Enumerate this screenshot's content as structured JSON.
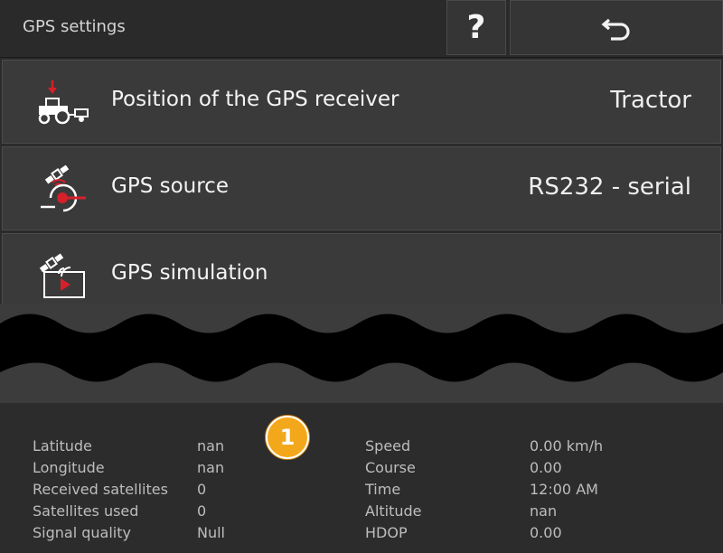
{
  "header": {
    "title": "GPS settings",
    "help_label": "?"
  },
  "menu": [
    {
      "label": "Position of the GPS receiver",
      "value": "Tractor",
      "icon": "tractor-receiver-icon"
    },
    {
      "label": "GPS source",
      "value": "RS232 - serial",
      "icon": "gps-source-icon"
    },
    {
      "label": "GPS simulation",
      "value": "",
      "icon": "gps-simulation-icon"
    }
  ],
  "callout": "1",
  "info": {
    "left": [
      {
        "label": "Latitude",
        "value": "nan"
      },
      {
        "label": "Longitude",
        "value": "nan"
      },
      {
        "label": "Received satellites",
        "value": "0"
      },
      {
        "label": "Satellites used",
        "value": "0"
      },
      {
        "label": "Signal quality",
        "value": "Null"
      }
    ],
    "right": [
      {
        "label": "Speed",
        "value": "0.00 km/h"
      },
      {
        "label": "Course",
        "value": "0.00"
      },
      {
        "label": "Time",
        "value": "12:00 AM"
      },
      {
        "label": "Altitude",
        "value": "nan"
      },
      {
        "label": "HDOP",
        "value": "0.00"
      }
    ]
  },
  "colors": {
    "accent_red": "#d6202a",
    "badge": "#f3a81b",
    "background": "#2b2b2b"
  }
}
